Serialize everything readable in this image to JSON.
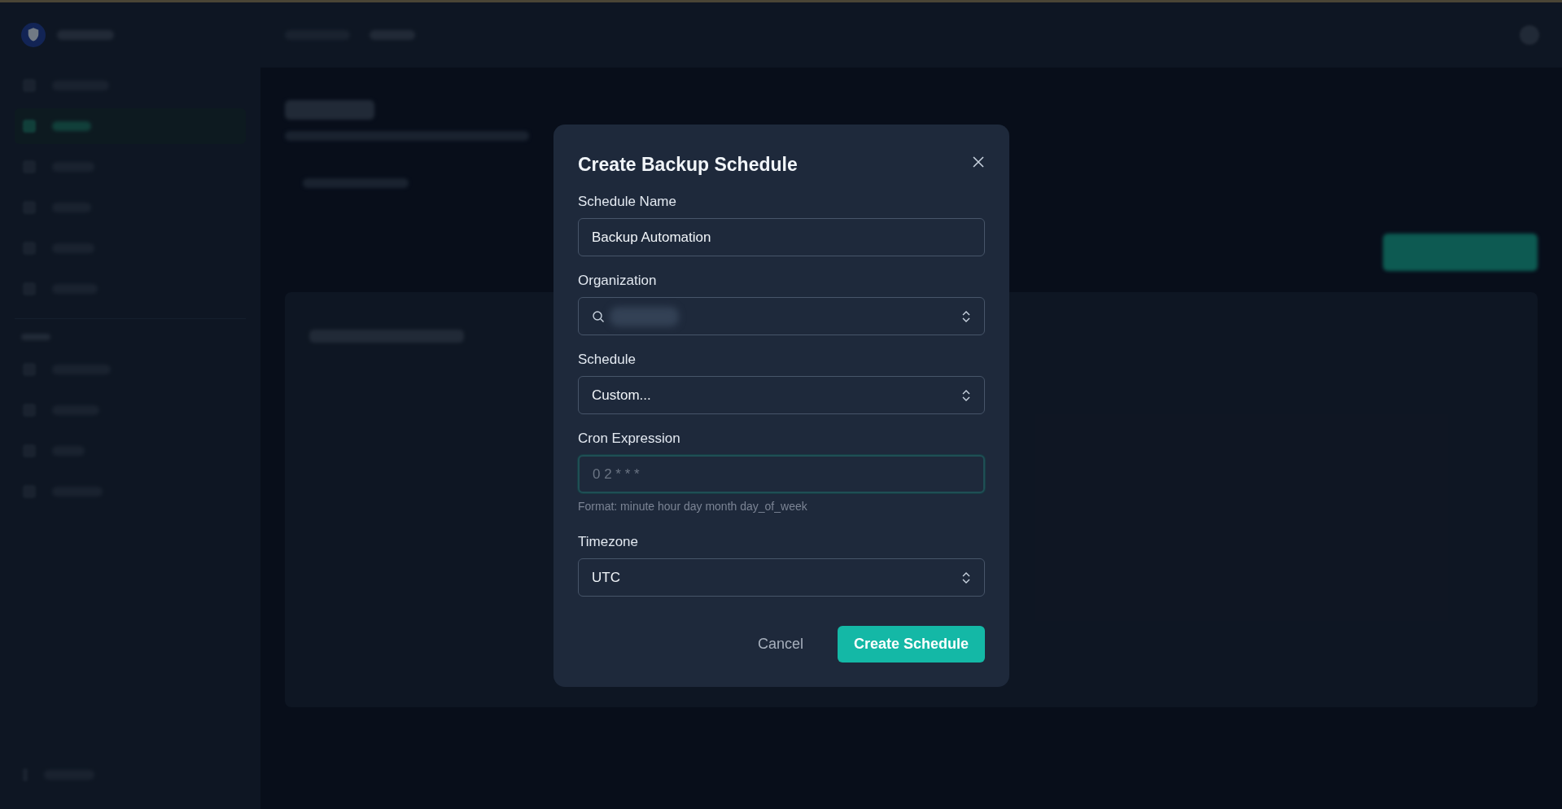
{
  "sidebar": {
    "items": [
      {
        "selected": false
      },
      {
        "selected": true
      },
      {
        "selected": false
      },
      {
        "selected": false
      },
      {
        "selected": false
      },
      {
        "selected": false
      },
      {
        "selected": false
      },
      {
        "selected": false
      },
      {
        "selected": false
      },
      {
        "selected": false
      }
    ]
  },
  "dialog": {
    "title": "Create Backup Schedule",
    "fields": [
      {
        "kind": "text",
        "label": "Schedule Name",
        "value": "Backup Automation",
        "focused": false
      },
      {
        "kind": "search-select",
        "label": "Organization",
        "redacted": true,
        "focused": false
      },
      {
        "kind": "select",
        "label": "Schedule",
        "value": "Custom...",
        "focused": false
      },
      {
        "kind": "text",
        "label": "Cron Expression",
        "placeholder": "0 2 * * *",
        "hint": "Format: minute hour day month day_of_week",
        "focused": true
      },
      {
        "kind": "select",
        "label": "Timezone",
        "value": "UTC",
        "focused": false
      }
    ],
    "cancel": "Cancel",
    "submit": "Create Schedule"
  }
}
